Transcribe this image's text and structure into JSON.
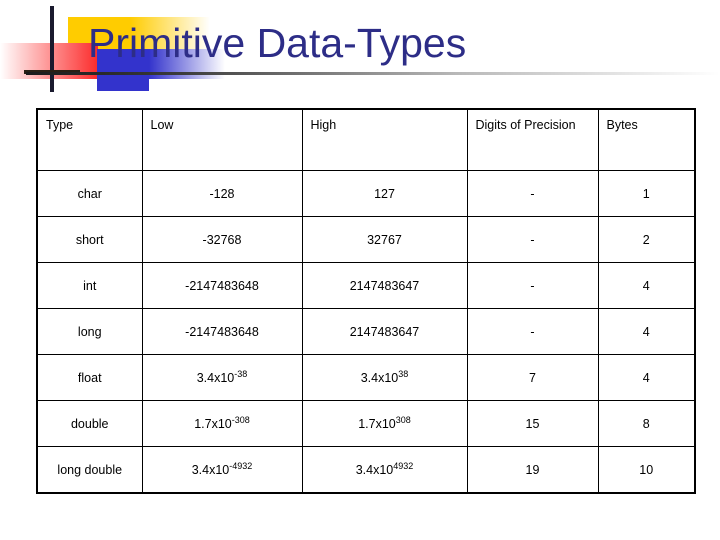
{
  "slide": {
    "title": "Primitive Data-Types"
  },
  "table": {
    "headers": [
      "Type",
      "Low",
      "High",
      "Digits of Precision",
      "Bytes"
    ],
    "rows": [
      {
        "type": "char",
        "low": "-128",
        "low_exp": "",
        "high": "127",
        "high_exp": "",
        "digits": "-",
        "bytes": "1"
      },
      {
        "type": "short",
        "low": "-32768",
        "low_exp": "",
        "high": "32767",
        "high_exp": "",
        "digits": "-",
        "bytes": "2"
      },
      {
        "type": "int",
        "low": "-2147483648",
        "low_exp": "",
        "high": "2147483647",
        "high_exp": "",
        "digits": "-",
        "bytes": "4"
      },
      {
        "type": "long",
        "low": "-2147483648",
        "low_exp": "",
        "high": "2147483647",
        "high_exp": "",
        "digits": "-",
        "bytes": "4"
      },
      {
        "type": "float",
        "low": "3.4x10",
        "low_exp": "-38",
        "high": "3.4x10",
        "high_exp": "38",
        "digits": "7",
        "bytes": "4"
      },
      {
        "type": "double",
        "low": "1.7x10",
        "low_exp": "-308",
        "high": "1.7x10",
        "high_exp": "308",
        "digits": "15",
        "bytes": "8"
      },
      {
        "type": "long double",
        "low": "3.4x10",
        "low_exp": "-4932",
        "high": "3.4x10",
        "high_exp": "4932",
        "digits": "19",
        "bytes": "10"
      }
    ]
  },
  "colors": {
    "title": "#2d2d87",
    "decor_yellow": "#ffcc00",
    "decor_red": "#fc2b2b",
    "decor_blue": "#3333cc",
    "rule": "#1a1a1a"
  }
}
